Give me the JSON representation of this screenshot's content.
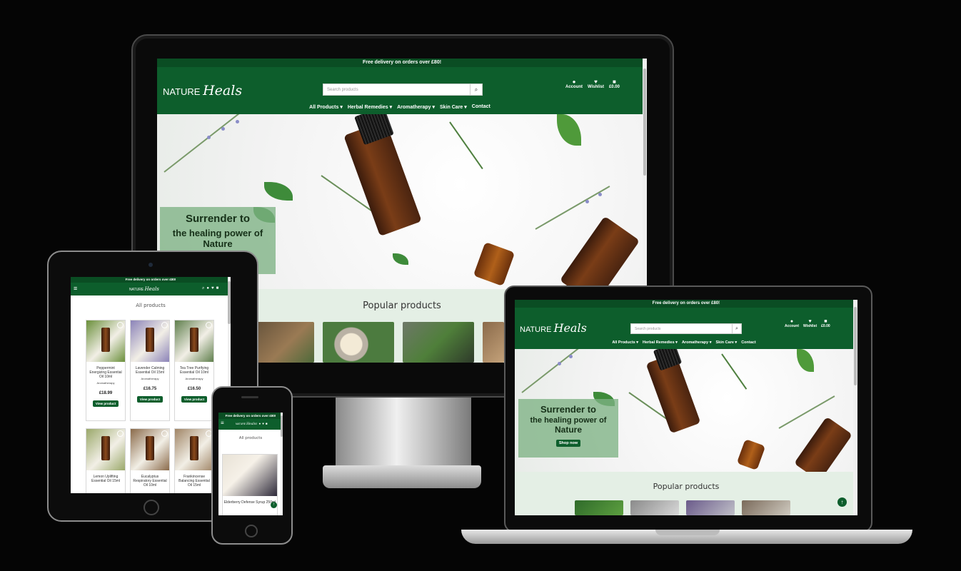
{
  "site": {
    "banner": "Free delivery on orders over £80!",
    "logo_prefix": "NATURE",
    "logo_script": "Heals",
    "search_placeholder": "Search products",
    "nav": [
      "All Products ▾",
      "Herbal Remedies ▾",
      "Aromatherapy ▾",
      "Skin Care ▾",
      "Contact"
    ],
    "account": [
      "Account",
      "Wishlist",
      "£0.00"
    ],
    "hero_line1": "Surrender to",
    "hero_line2": "the healing power of",
    "hero_line3": "Nature",
    "hero_button": "Shop now",
    "popular_title": "Popular products",
    "products_title": "All products"
  },
  "tablet_products": [
    {
      "name": "Peppermint Energizing Essential Oil 10ml",
      "category": "Aromatherapy",
      "price": "£18.99",
      "button": "View product",
      "tone": "#6a8f3a"
    },
    {
      "name": "Lavender Calming Essential Oil 15ml",
      "category": "Aromatherapy",
      "price": "£16.75",
      "button": "View product",
      "tone": "#8b83b8"
    },
    {
      "name": "Tea Tree Purifying Essential Oil 10ml",
      "category": "Aromatherapy",
      "price": "£16.50",
      "button": "View product",
      "tone": "#5f7f4c"
    },
    {
      "name": "Lemon Uplifting Essential Oil 15ml",
      "category": "",
      "price": "",
      "button": "",
      "tone": "#9aa86a"
    },
    {
      "name": "Eucalyptus Respiratory Essential Oil 10ml",
      "category": "",
      "price": "",
      "button": "",
      "tone": "#8a6a4a"
    },
    {
      "name": "Frankincense Balancing Essential Oil 15ml",
      "category": "",
      "price": "",
      "button": "",
      "tone": "#a08566"
    }
  ],
  "phone_product": {
    "name": "Elderberry Defense Syrup 250ml",
    "tone": "#2e2a3a"
  },
  "colors": {
    "brand_green": "#0d5e2c",
    "overlay_green": "#7eb284",
    "popular_bg": "#e4efe5"
  },
  "icons": [
    "user-icon",
    "heart-icon",
    "bag-icon",
    "search-icon",
    "hamburger-icon",
    "arrow-up-icon"
  ]
}
